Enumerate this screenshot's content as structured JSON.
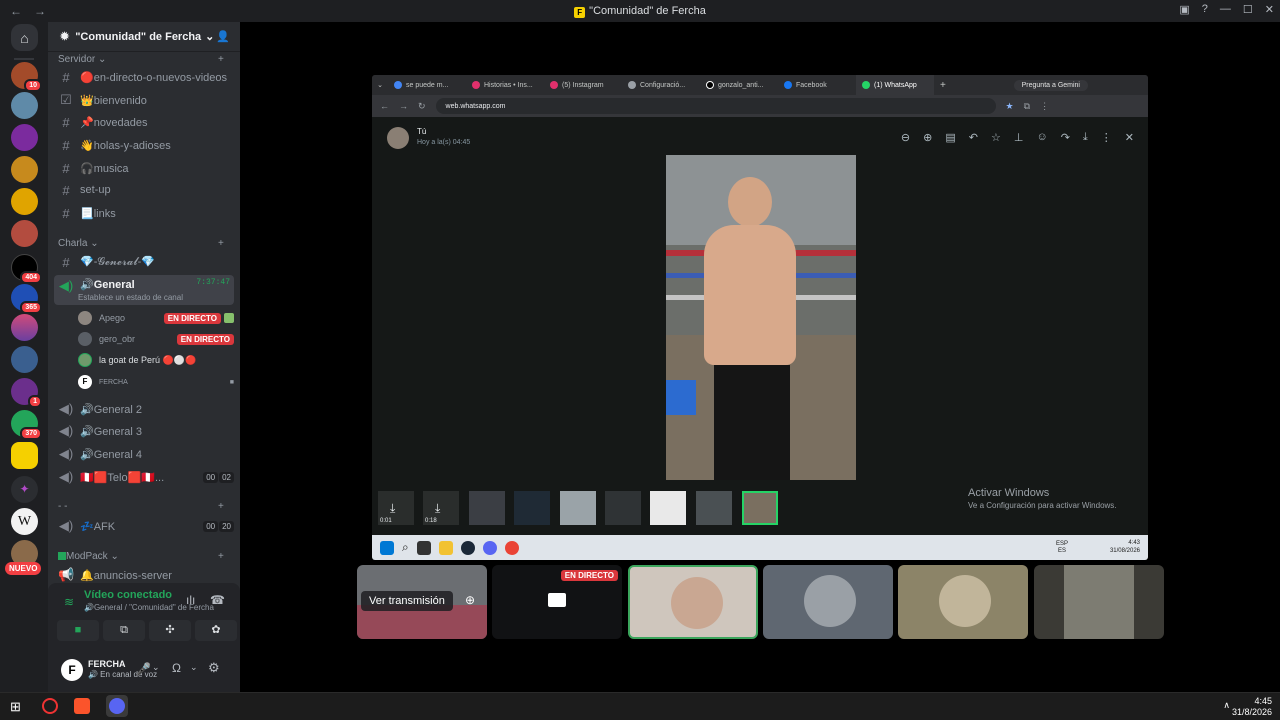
{
  "window": {
    "title": "\"Comunidad\" de Fercha",
    "back": "←",
    "forward": "→"
  },
  "guild": {
    "name": "\"Comunidad\" de Fercha"
  },
  "categories": {
    "servidor": "Servidor",
    "charla": "Charla",
    "empty": "- -",
    "modpack": "ModPack"
  },
  "text_channels": [
    {
      "name": "🔴en-directo-o-nuevos-videos"
    },
    {
      "name": "👑bienvenido"
    },
    {
      "name": "📌novedades"
    },
    {
      "name": "👋holas-y-adioses"
    },
    {
      "name": "🎧musica"
    },
    {
      "name": "set-up"
    },
    {
      "name": "📃links"
    }
  ],
  "charla_text": {
    "name": "💎-𝓖𝓮𝓷𝓮𝓻𝓪𝓵-💎"
  },
  "active_voice": {
    "name": "🔊General",
    "time": "7:37:47",
    "status": "Establece un estado de canal"
  },
  "voice_users": [
    {
      "name": "Apego",
      "live": "EN DIRECTO"
    },
    {
      "name": "gero_obr",
      "live": "EN DIRECTO"
    },
    {
      "name": "la goat de Perú 🔴⚪🔴",
      "live": ""
    },
    {
      "name": "FERCHA",
      "live": ""
    }
  ],
  "voice_channels": [
    {
      "name": "🔊General 2"
    },
    {
      "name": "🔊General 3"
    },
    {
      "name": "🔊General 4"
    },
    {
      "name": "🇵🇪🟥Telo🟥🇵🇪...",
      "c1": "00",
      "c2": "02"
    }
  ],
  "afk": {
    "name": "💤AFK",
    "c1": "00",
    "c2": "20"
  },
  "announce": {
    "name": "🔔anuncios-server"
  },
  "voice_panel": {
    "status": "Vídeo conectado",
    "channel": "🔊General / \"Comunidad\" de Fercha"
  },
  "user_panel": {
    "name": "FERCHA",
    "status": "🔊 En canal de voz"
  },
  "new_badge": "NUEVO",
  "server_badges": [
    "10",
    "404",
    "365",
    "1",
    "370"
  ],
  "browser": {
    "tabs": [
      "se puede m...",
      "Historias • Ins...",
      "(5) Instagram",
      "Configuració...",
      "gonzalo_anti...",
      "Facebook",
      "(1) WhatsApp"
    ],
    "gemini": "Pregunta a Gemini",
    "url": "web.whatsapp.com",
    "viewer_name": "Tú",
    "viewer_time": "Hoy a la(s) 04:45",
    "thumb_labels": [
      "0:01",
      "0:18"
    ],
    "activate_title": "Activar Windows",
    "activate_sub": "Ve a Configuración para activar Windows.",
    "lang": "ESP\nES",
    "clock_time": "4:43",
    "clock_date": "31/08/2026"
  },
  "tiles": {
    "watch_label": "Ver transmisión",
    "live_label": "EN DIRECTO"
  },
  "os": {
    "time": "4:45",
    "date": "31/8/2026"
  },
  "colors": {
    "accent": "#23a55a",
    "live": "#da373c",
    "selected_tile": "#3ba55c"
  }
}
